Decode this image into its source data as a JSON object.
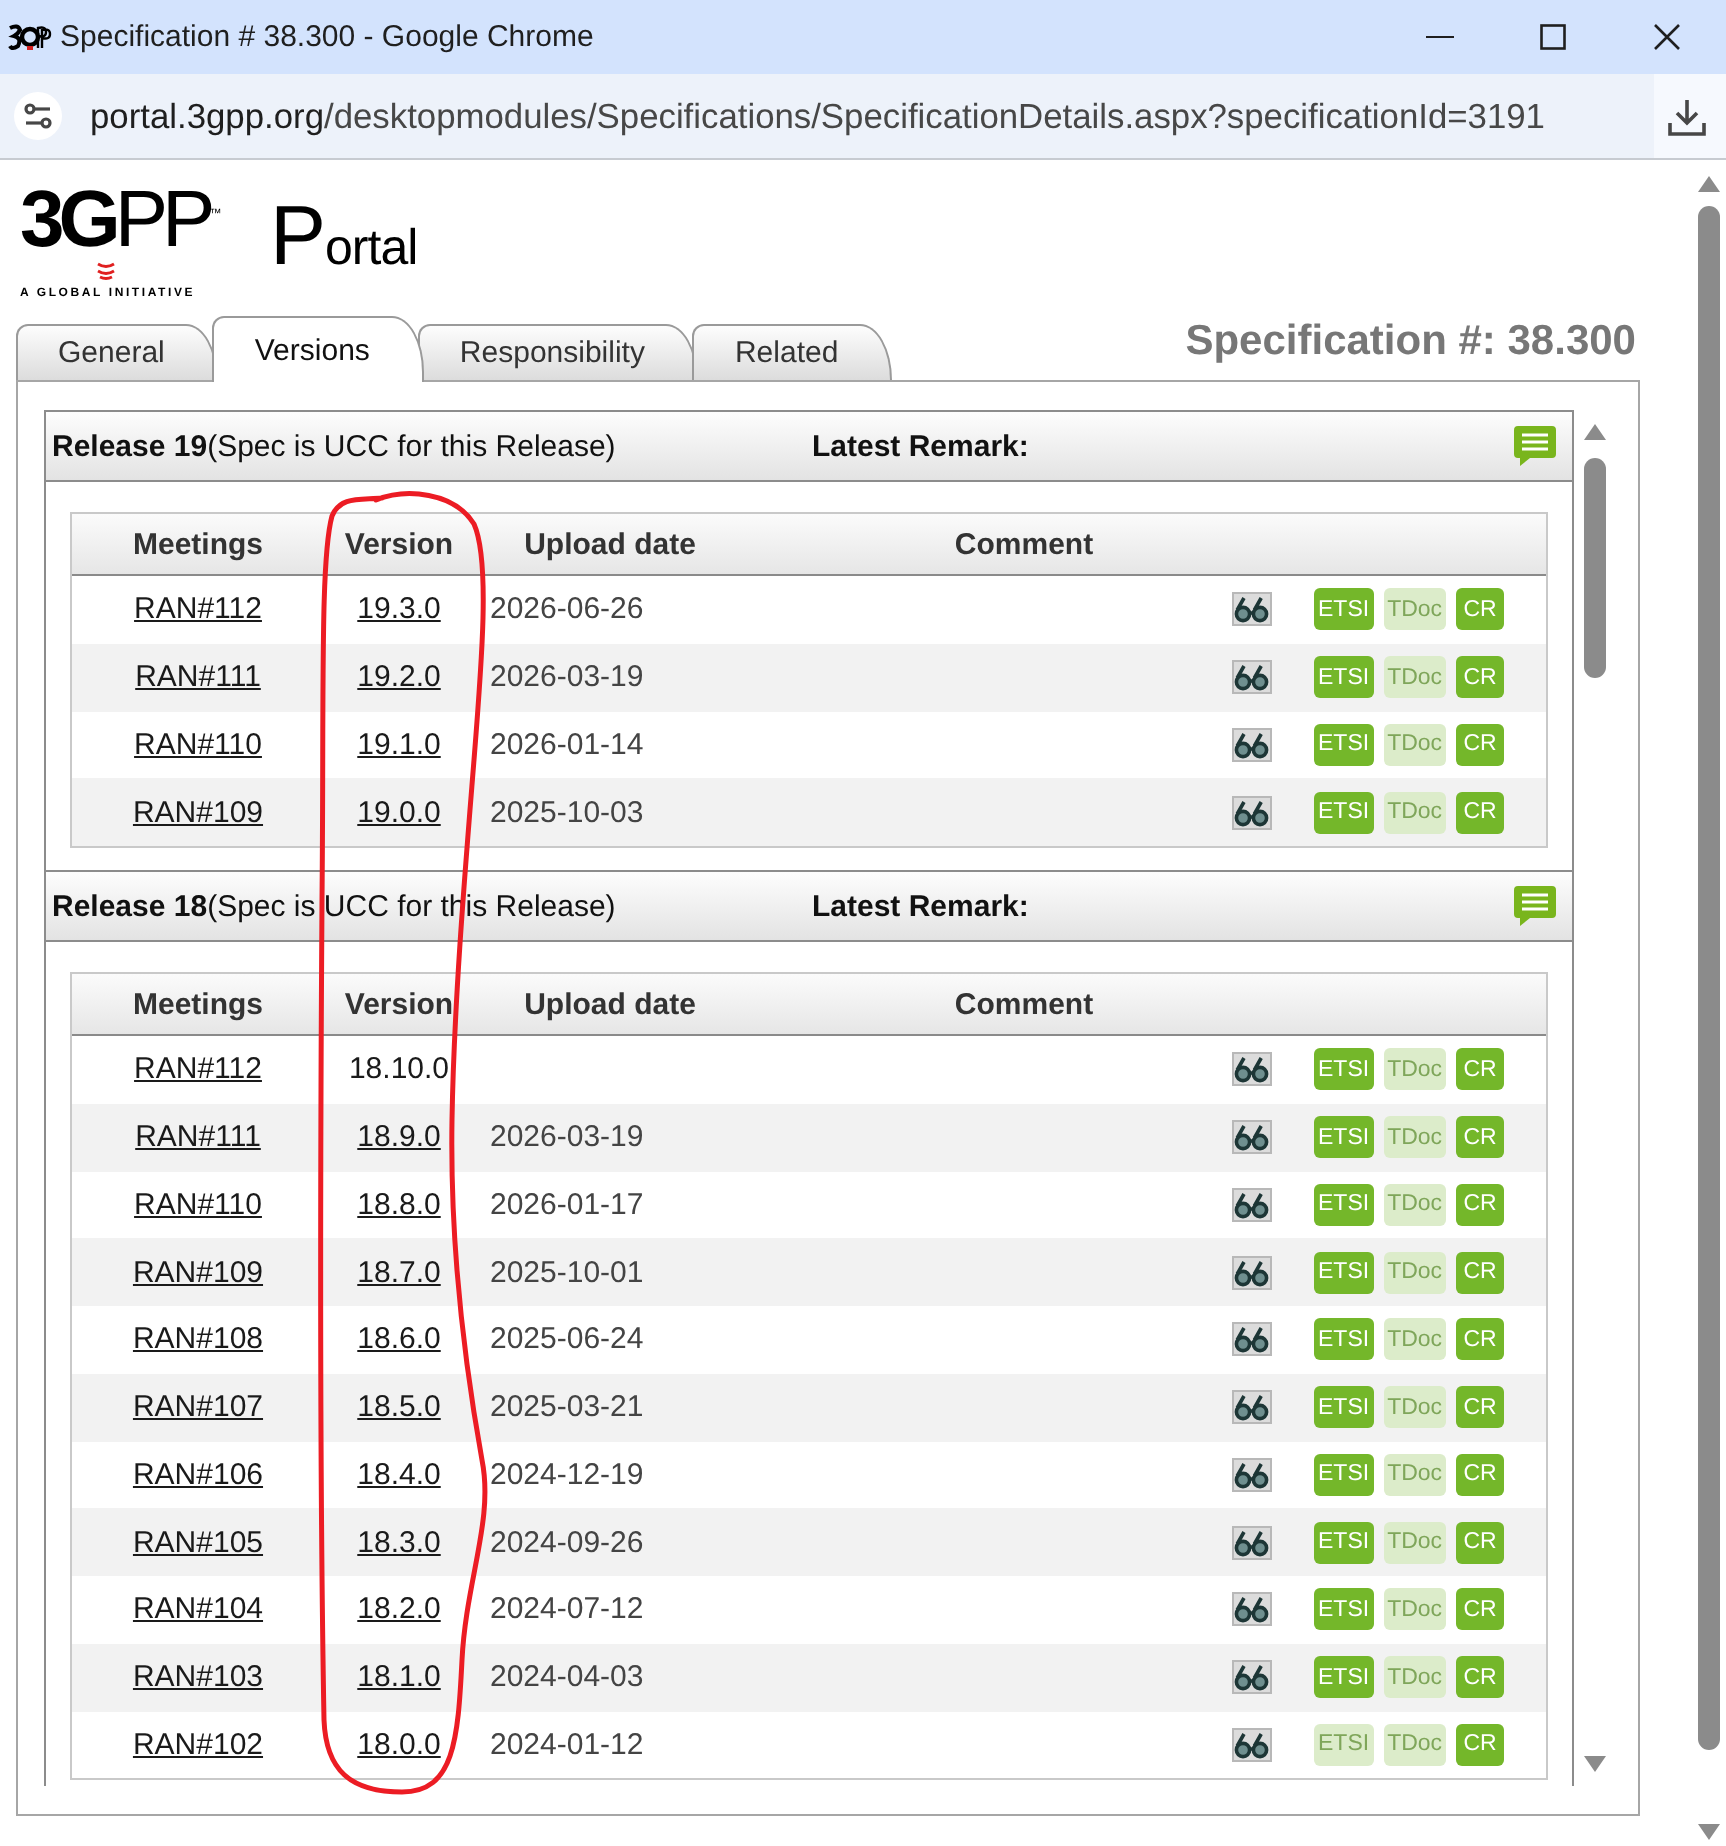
{
  "window": {
    "title": "Specification # 38.300 - Google Chrome"
  },
  "address_bar": {
    "host": "portal.3gpp.org",
    "path": "/desktopmodules/Specifications/SpecificationDetails.aspx?specificationId=3191"
  },
  "header": {
    "logo": {
      "wordmark": "**3G**PP$^{™}$",
      "tagline": "A GLOBAL INITIATIVE"
    },
    "portal": "Portal",
    "spec_number": "Specification #: 38.300"
  },
  "tabs": [
    {
      "label": "General",
      "selected": false
    },
    {
      "label": "Versions",
      "selected": true
    },
    {
      "label": "Responsibility",
      "selected": false
    },
    {
      "label": "Related",
      "selected": false
    }
  ],
  "releases": [
    {
      "title": "**Release 19**(Spec is UCC for this Release)",
      "remark_label": "Latest Remark:",
      "columns": [
        "Meetings",
        "Version",
        "Upload date",
        "Comment"
      ],
      "rows": [
        {
          "meeting": "RAN#112",
          "version": "19.3.0",
          "version_linked": true,
          "upload_date": "2026-06-26",
          "links": [
            {
              "label": "ETSI",
              "disabled": false
            },
            {
              "label": "TDoc",
              "disabled": true
            },
            {
              "label": "CR",
              "disabled": false
            }
          ]
        },
        {
          "meeting": "RAN#111",
          "version": "19.2.0",
          "version_linked": true,
          "upload_date": "2026-03-19",
          "links": [
            {
              "label": "ETSI",
              "disabled": false
            },
            {
              "label": "TDoc",
              "disabled": true
            },
            {
              "label": "CR",
              "disabled": false
            }
          ]
        },
        {
          "meeting": "RAN#110",
          "version": "19.1.0",
          "version_linked": true,
          "upload_date": "2026-01-14",
          "links": [
            {
              "label": "ETSI",
              "disabled": false
            },
            {
              "label": "TDoc",
              "disabled": true
            },
            {
              "label": "CR",
              "disabled": false
            }
          ]
        },
        {
          "meeting": "RAN#109",
          "version": "19.0.0",
          "version_linked": true,
          "upload_date": "2025-10-03",
          "links": [
            {
              "label": "ETSI",
              "disabled": false
            },
            {
              "label": "TDoc",
              "disabled": true
            },
            {
              "label": "CR",
              "disabled": false
            }
          ]
        }
      ]
    },
    {
      "title": "**Release 18**(Spec is UCC for this Release)",
      "remark_label": "Latest Remark:",
      "columns": [
        "Meetings",
        "Version",
        "Upload date",
        "Comment"
      ],
      "rows": [
        {
          "meeting": "RAN#112",
          "version": "18.10.0",
          "version_linked": false,
          "links": [
            {
              "label": "ETSI",
              "disabled": false
            },
            {
              "label": "TDoc",
              "disabled": true
            },
            {
              "label": "CR",
              "disabled": false
            }
          ]
        },
        {
          "meeting": "RAN#111",
          "version": "18.9.0",
          "version_linked": true,
          "upload_date": "2026-03-19",
          "links": [
            {
              "label": "ETSI",
              "disabled": false
            },
            {
              "label": "TDoc",
              "disabled": true
            },
            {
              "label": "CR",
              "disabled": false
            }
          ]
        },
        {
          "meeting": "RAN#110",
          "version": "18.8.0",
          "version_linked": true,
          "upload_date": "2026-01-17",
          "links": [
            {
              "label": "ETSI",
              "disabled": false
            },
            {
              "label": "TDoc",
              "disabled": true
            },
            {
              "label": "CR",
              "disabled": false
            }
          ]
        },
        {
          "meeting": "RAN#109",
          "version": "18.7.0",
          "version_linked": true,
          "upload_date": "2025-10-01",
          "links": [
            {
              "label": "ETSI",
              "disabled": false
            },
            {
              "label": "TDoc",
              "disabled": true
            },
            {
              "label": "CR",
              "disabled": false
            }
          ]
        },
        {
          "meeting": "RAN#108",
          "version": "18.6.0",
          "version_linked": true,
          "upload_date": "2025-06-24",
          "links": [
            {
              "label": "ETSI",
              "disabled": false
            },
            {
              "label": "TDoc",
              "disabled": true
            },
            {
              "label": "CR",
              "disabled": false
            }
          ]
        },
        {
          "meeting": "RAN#107",
          "version": "18.5.0",
          "version_linked": true,
          "upload_date": "2025-03-21",
          "links": [
            {
              "label": "ETSI",
              "disabled": false
            },
            {
              "label": "TDoc",
              "disabled": true
            },
            {
              "label": "CR",
              "disabled": false
            }
          ]
        },
        {
          "meeting": "RAN#106",
          "version": "18.4.0",
          "version_linked": true,
          "upload_date": "2024-12-19",
          "links": [
            {
              "label": "ETSI",
              "disabled": false
            },
            {
              "label": "TDoc",
              "disabled": true
            },
            {
              "label": "CR",
              "disabled": false
            }
          ]
        },
        {
          "meeting": "RAN#105",
          "version": "18.3.0",
          "version_linked": true,
          "upload_date": "2024-09-26",
          "links": [
            {
              "label": "ETSI",
              "disabled": false
            },
            {
              "label": "TDoc",
              "disabled": true
            },
            {
              "label": "CR",
              "disabled": false
            }
          ]
        },
        {
          "meeting": "RAN#104",
          "version": "18.2.0",
          "version_linked": true,
          "upload_date": "2024-07-12",
          "links": [
            {
              "label": "ETSI",
              "disabled": false
            },
            {
              "label": "TDoc",
              "disabled": true
            },
            {
              "label": "CR",
              "disabled": false
            }
          ]
        },
        {
          "meeting": "RAN#103",
          "version": "18.1.0",
          "version_linked": true,
          "upload_date": "2024-04-03",
          "links": [
            {
              "label": "ETSI",
              "disabled": false
            },
            {
              "label": "TDoc",
              "disabled": true
            },
            {
              "label": "CR",
              "disabled": false
            }
          ]
        },
        {
          "meeting": "RAN#102",
          "version": "18.0.0",
          "version_linked": true,
          "upload_date": "2024-01-12",
          "links": [
            {
              "label": "ETSI",
              "disabled": true
            },
            {
              "label": "TDoc",
              "disabled": true
            },
            {
              "label": "CR",
              "disabled": false
            }
          ]
        }
      ]
    }
  ]
}
